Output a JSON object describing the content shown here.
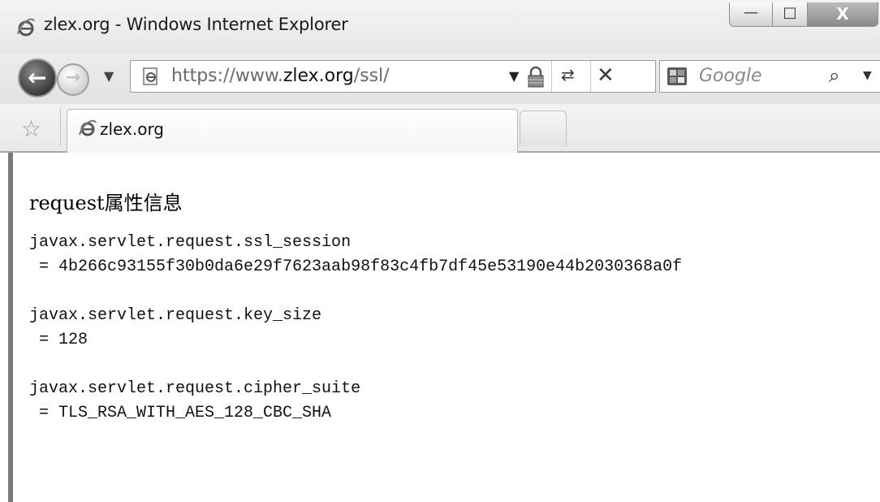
{
  "window": {
    "title": "zlex.org - Windows Internet Explorer",
    "controls": {
      "minimize": "—",
      "maximize": "□",
      "close": "X"
    }
  },
  "nav": {
    "url_scheme": "https://www.",
    "url_domain": "zlex.org",
    "url_path": "/ssl/",
    "search_placeholder": "Google"
  },
  "tab": {
    "label": "zlex.org"
  },
  "page": {
    "heading": "request属性信息",
    "entries": [
      {
        "name": "javax.servlet.request.ssl_session",
        "value": " = 4b266c93155f30b0da6e29f7623aab98f83c4fb7df45e53190e44b2030368a0f"
      },
      {
        "name": "javax.servlet.request.key_size",
        "value": " = 128"
      },
      {
        "name": "javax.servlet.request.cipher_suite",
        "value": " = TLS_RSA_WITH_AES_128_CBC_SHA"
      }
    ]
  },
  "icons": {
    "browser": "ie-icon",
    "back": "back-arrow-icon",
    "forward": "forward-arrow-icon",
    "lock": "lock-icon",
    "refresh": "refresh-icon",
    "stop": "stop-icon",
    "search_provider": "google-icon",
    "search": "search-icon",
    "favorites": "favorites-star-icon"
  },
  "colors": {
    "background": "#ffffff",
    "chrome": "#ececec",
    "text": "#111111"
  }
}
